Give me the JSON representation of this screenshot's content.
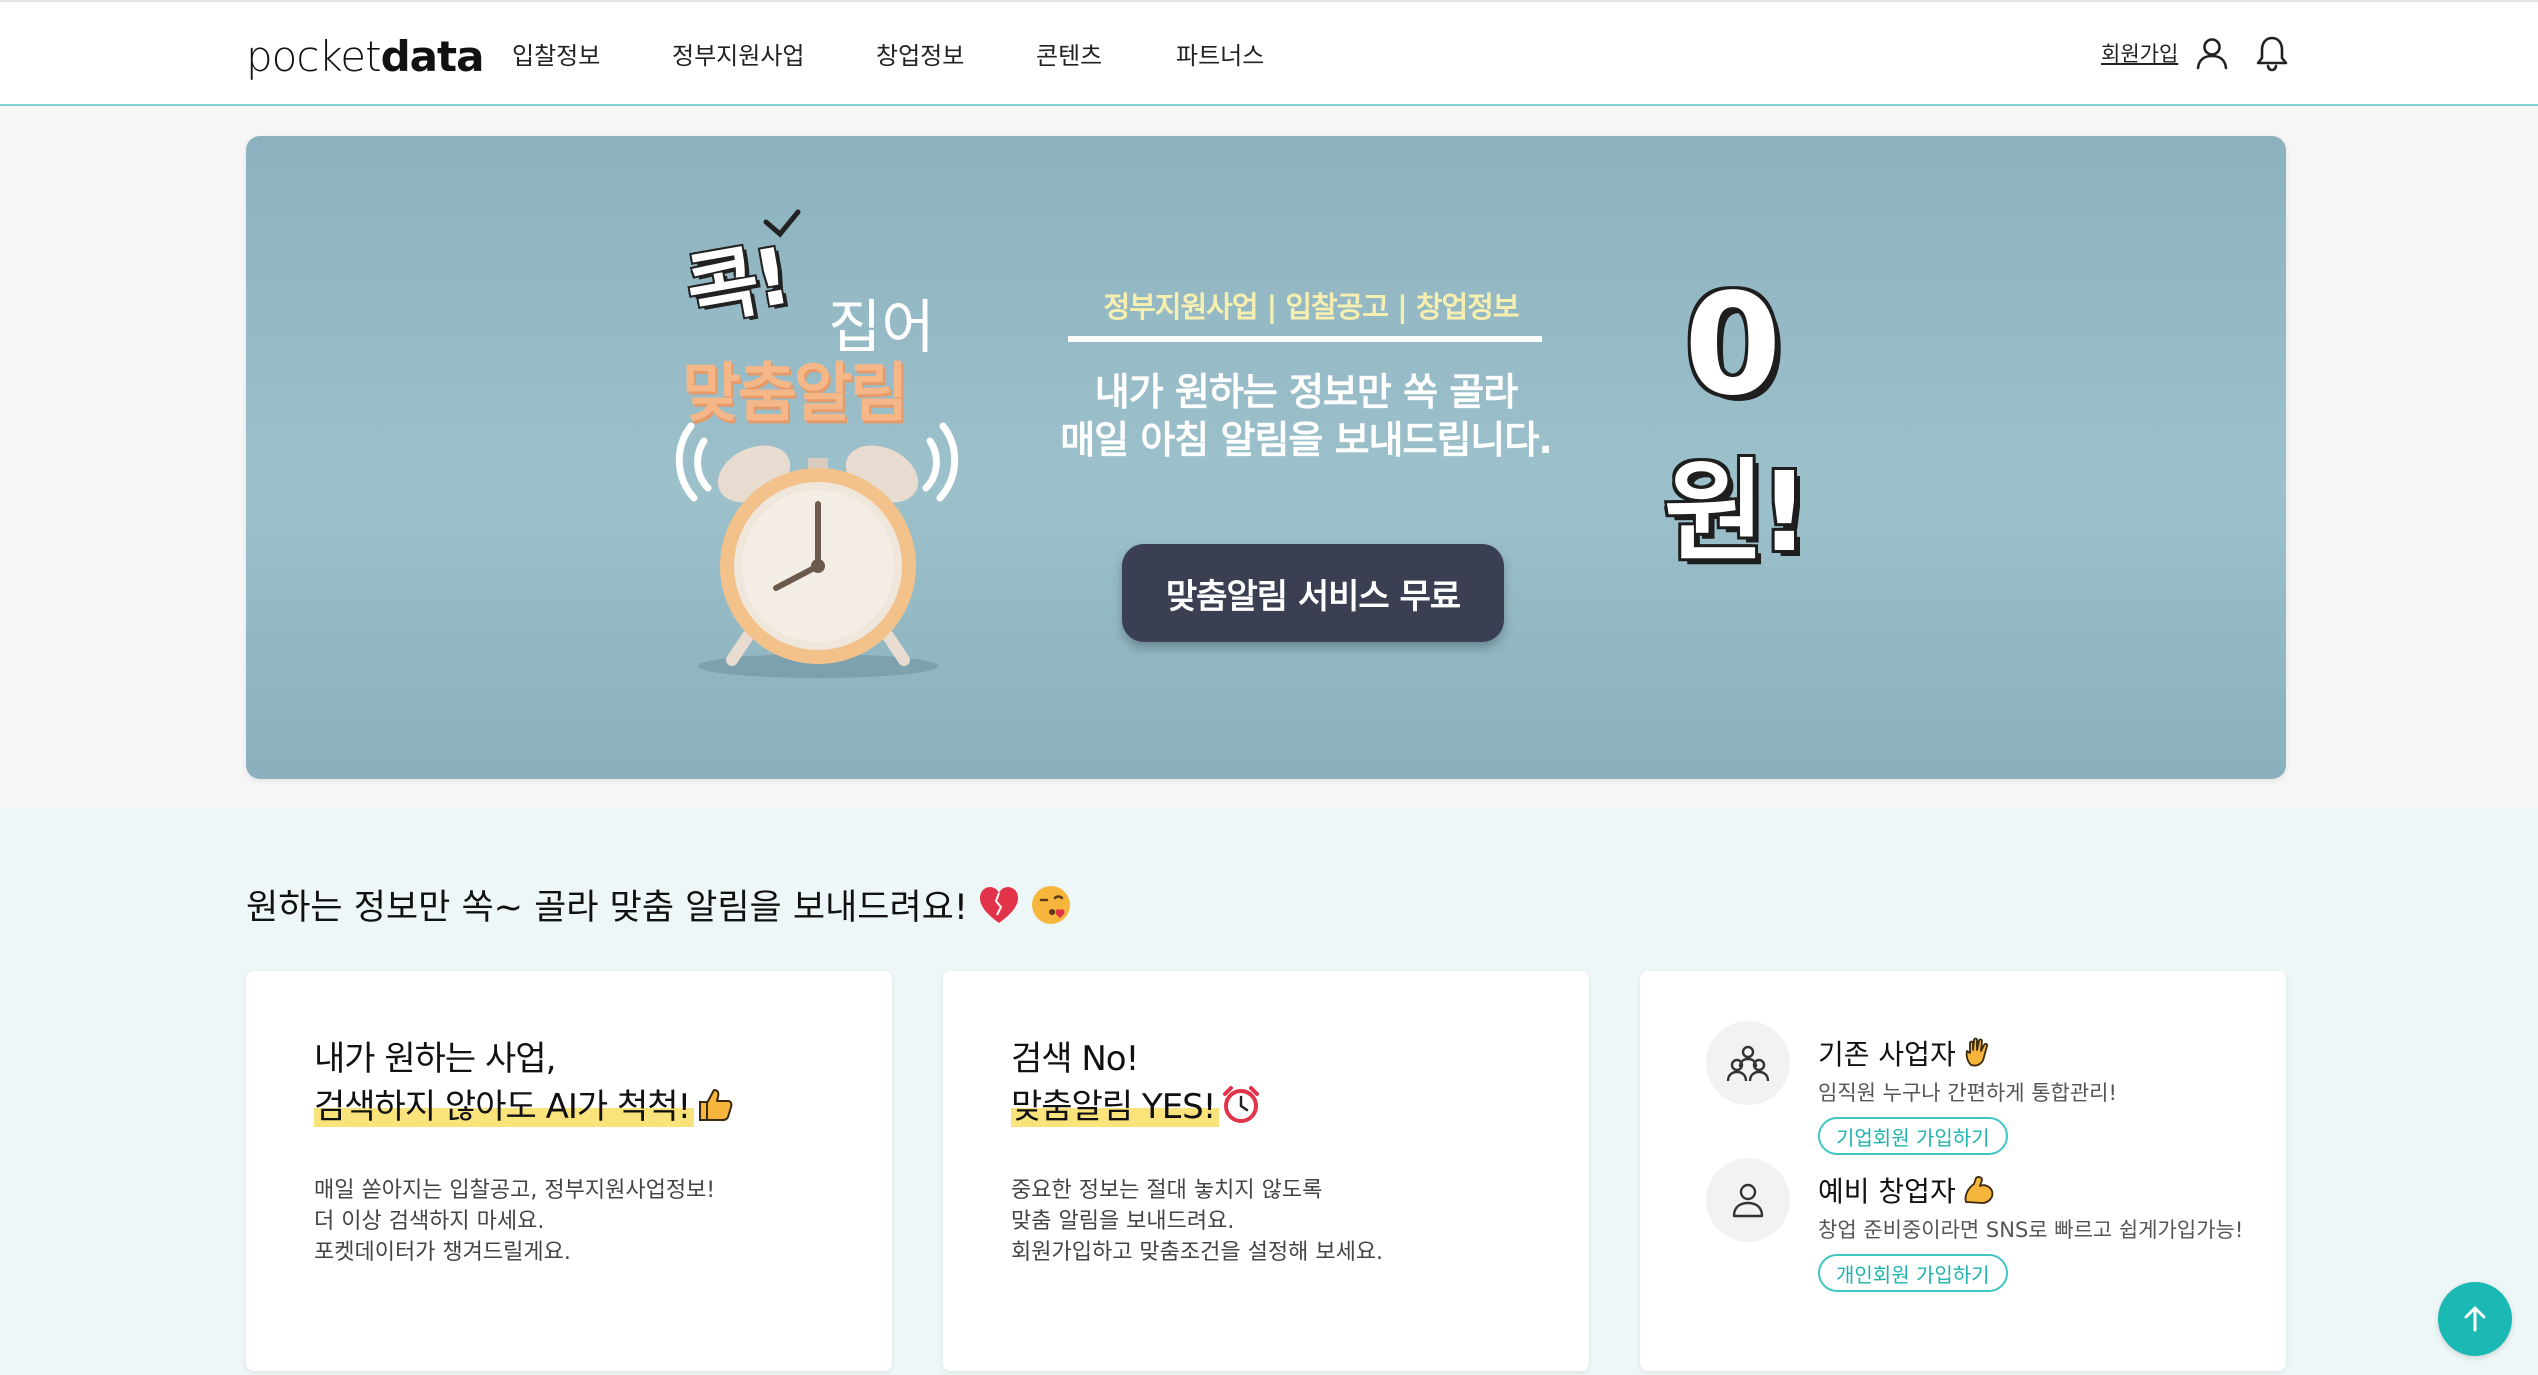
{
  "header": {
    "logo_light": "pocket",
    "logo_bold": "data",
    "nav": [
      "입찰정보",
      "정부지원사업",
      "창업정보",
      "콘텐츠",
      "파트너스"
    ],
    "signup_label": "회원가입"
  },
  "banner": {
    "title_1": "콕!",
    "title_2": "집어",
    "title_3": "맞춤알림",
    "sub": "정부지원사업 | 입찰공고 | 창업정보",
    "main_line_1": "내가 원하는 정보만 쏙 골라",
    "main_line_2": "매일 아침 알림을 보내드립니다.",
    "button_label": "맞춤알림 서비스 무료",
    "price_1": "0",
    "price_2": "원!",
    "colors": {
      "background": "#8db2bf",
      "button": "#3a3f52",
      "accent": "#f6b788"
    }
  },
  "section": {
    "title": "원하는 정보만 쏙~ 골라 맞춤 알림을 보내드려요!"
  },
  "cards": [
    {
      "head_1": "내가 원하는 사업,",
      "head_2": "검색하지 않아도 AI가 척척!",
      "body": [
        "매일 쏟아지는 입찰공고, 정부지원사업정보!",
        "더 이상 검색하지 마세요.",
        "포켓데이터가 챙겨드릴게요."
      ]
    },
    {
      "head_1": "검색 No!",
      "head_2": "맞춤알림 YES!",
      "body": [
        "중요한 정보는 절대 놓치지 않도록",
        "맞춤 알림을 보내드려요.",
        "회원가입하고 맞춤조건을 설정해 보세요."
      ]
    }
  ],
  "members": [
    {
      "title": "기존 사업자",
      "desc": "임직원 누구나 간편하게 통합관리!",
      "button": "기업회원 가입하기"
    },
    {
      "title": "예비 창업자",
      "desc": "창업 준비중이라면 SNS로 빠르고 쉽게가입가능!",
      "button": "개인회원 가입하기"
    }
  ],
  "colors": {
    "accent": "#1ab9b3",
    "highlight": "#fbe37c",
    "header_border": "#7fd3d0"
  }
}
